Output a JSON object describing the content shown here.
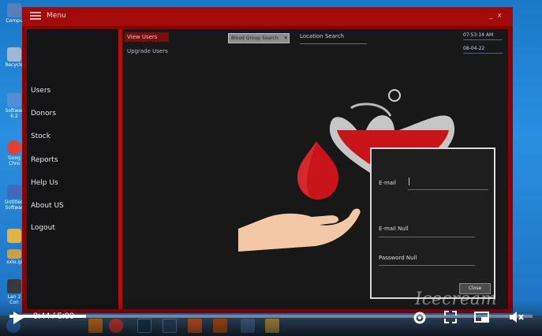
{
  "desktop": {
    "icons": [
      {
        "label": "Compu",
        "color": "#5a7fb8"
      },
      {
        "label": "Recycle",
        "color": "#9fb7cf"
      },
      {
        "label": "Softwar 6.2",
        "color": "#4f8fd6"
      },
      {
        "label": "Goog Chro",
        "color": "#e34133"
      },
      {
        "label": "Untitled Softwar",
        "color": "#3f6bbf"
      },
      {
        "label": "",
        "color": "#e0b24a"
      },
      {
        "label": "xxle.ip",
        "color": "#c9a04a"
      },
      {
        "label": "Lan 2 Con",
        "color": "#3a3a3a"
      }
    ]
  },
  "window": {
    "title": "Menu",
    "hamburger_icon": "hamburger-icon",
    "minimize": "_",
    "close": "x"
  },
  "sidebar": {
    "items": [
      {
        "label": "Users"
      },
      {
        "label": "Donors"
      },
      {
        "label": "Stock"
      },
      {
        "label": "Reports"
      },
      {
        "label": "Help Us"
      },
      {
        "label": "About US"
      },
      {
        "label": "Logout"
      }
    ]
  },
  "submenu": {
    "view_users": "View Users",
    "upgrade_users": "Upgrade Users"
  },
  "toolbar": {
    "search_button": "Blood Group Search",
    "location_search": "Location Search",
    "time": "07:53:14 AM",
    "date": "08-04-22"
  },
  "popup": {
    "email_label": "E-mail",
    "email_value": "",
    "email_null_label": "E-mail Null",
    "password_null_label": "Password Null",
    "close_button": "Close"
  },
  "video": {
    "current_time": "0:44",
    "duration": "5:00",
    "time_display": "0:44 / 5:00",
    "progress": 0.1467,
    "watermark": "Icecream"
  },
  "colors": {
    "window_red": "#8b0000",
    "titlebar": "#a30b0b",
    "sidebar_bg": "#141414",
    "main_bg": "#181818",
    "blood": "#c8141a"
  }
}
